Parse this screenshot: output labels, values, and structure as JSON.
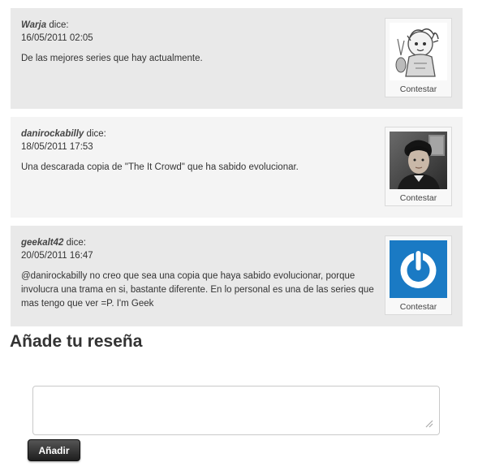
{
  "comments": [
    {
      "author": "Warja",
      "says": "dice:",
      "datetime": "16/05/2011 02:05",
      "text": "De las mejores series que hay actualmente.",
      "reply_label": "Contestar",
      "avatar": "cartoon-sketch-avatar"
    },
    {
      "author": "danirockabilly",
      "says": "dice:",
      "datetime": "18/05/2011 17:53",
      "text": "Una descarada copia de \"The It Crowd\" que ha sabido evolucionar.",
      "reply_label": "Contestar",
      "avatar": "photo-avatar"
    },
    {
      "author": "geekalt42",
      "says": "dice:",
      "datetime": "20/05/2011 16:47",
      "text": "@danirockabilly no creo que sea una copia que haya sabido evolucionar, porque involucra una trama en si, bastante diferente. En lo personal es una de las series que mas tengo que ver =P. I'm Geek",
      "reply_label": "Contestar",
      "avatar": "power-logo-avatar"
    }
  ],
  "review": {
    "title": "Añade tu reseña",
    "textarea_value": "",
    "submit_label": "Añadir"
  },
  "colors": {
    "comment_dark_bg": "#e9e9e9",
    "comment_light_bg": "#f4f4f4",
    "avatar_blue": "#1a7ac4",
    "button_dark": "#1e1e1e"
  }
}
